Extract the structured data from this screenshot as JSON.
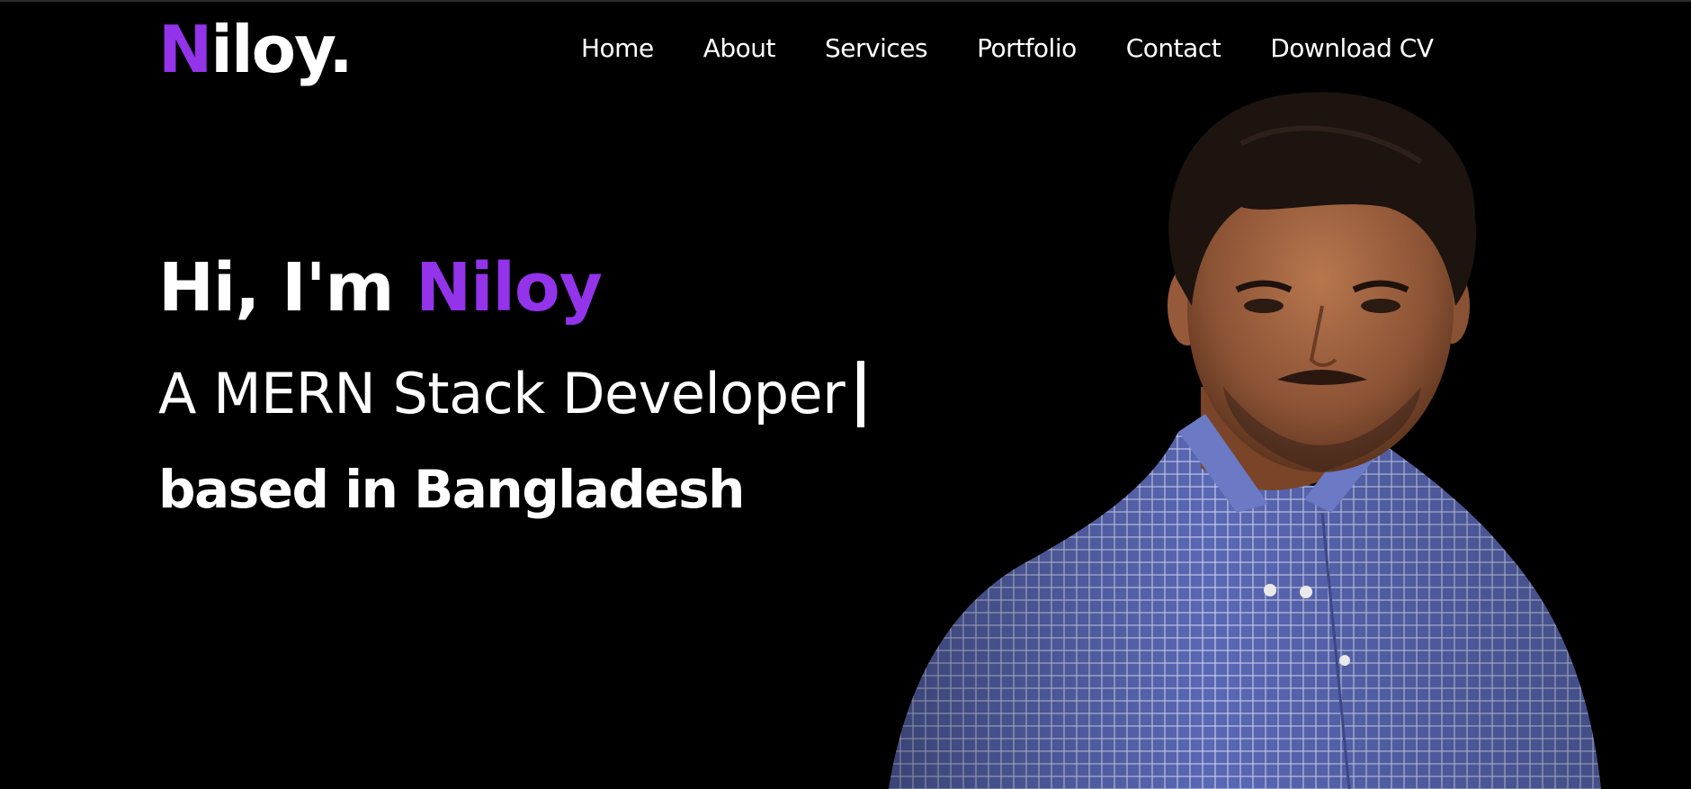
{
  "header": {
    "logo_main": "N",
    "logo_rest": "iloy.",
    "nav": [
      {
        "label": "Home"
      },
      {
        "label": "About"
      },
      {
        "label": "Services"
      },
      {
        "label": "Portfolio"
      },
      {
        "label": "Contact"
      },
      {
        "label": "Download CV"
      }
    ]
  },
  "hero": {
    "greeting": "Hi, I'm",
    "name": "Niloy",
    "role": "A MERN Stack Developer",
    "location": "based in Bangladesh"
  },
  "colors": {
    "accent": "#9333ea",
    "background": "#000000",
    "text": "#ffffff"
  },
  "icons": {
    "cursor": "typing-cursor"
  }
}
